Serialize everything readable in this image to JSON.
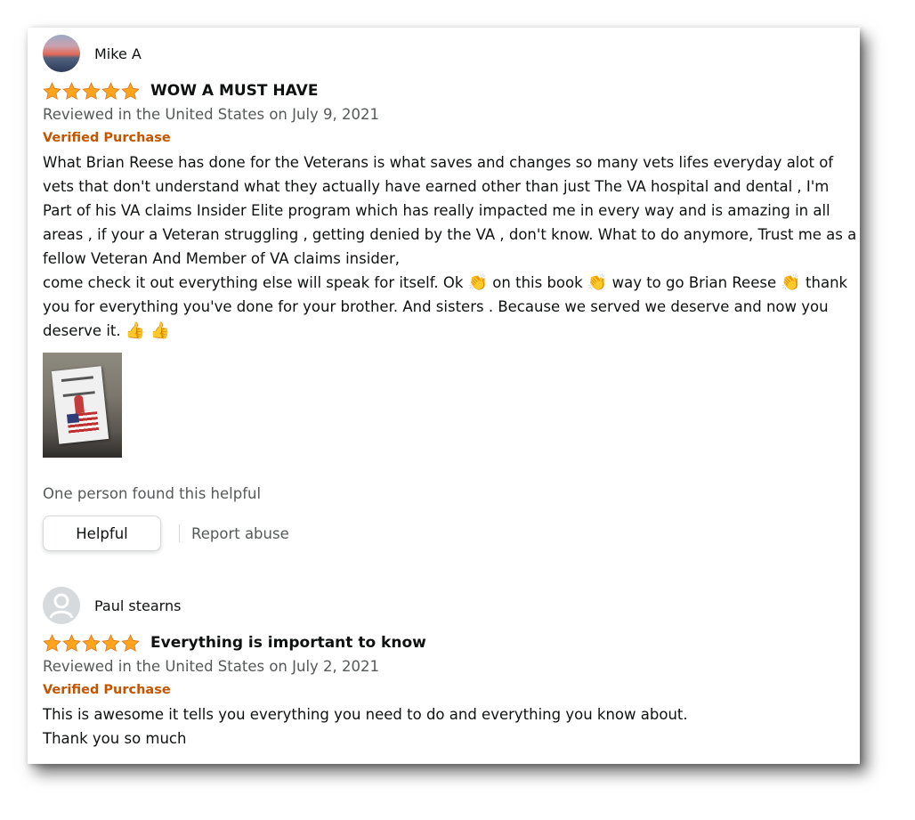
{
  "reviews": [
    {
      "reviewer": "Mike A",
      "rating": 5,
      "title": "WOW A MUST HAVE",
      "date": "Reviewed in the United States on July 9, 2021",
      "badge": "Verified Purchase",
      "body": [
        "What Brian Reese has done for the Veterans is what saves and changes so many vets lifes everyday alot of vets that don't understand what they actually have earned other than just The VA hospital and dental , I'm Part of his VA claims Insider Elite program which has really impacted me in every way and is amazing in all areas , if your a Veteran struggling , getting denied by the VA , don't know. What to do anymore, Trust me as a fellow Veteran And Member of VA claims insider,",
        "come check it out everything else will speak for itself. Ok",
        "on this book",
        "way to go Brian Reese",
        "thank you for everything you've done for your brother. And sisters . Because we served we deserve and now you deserve it."
      ],
      "emoji": {
        "clap": "👏",
        "thumbs_up": "👍"
      },
      "helpful_text": "One person found this helpful",
      "helpful_button": "Helpful",
      "report_link": "Report abuse"
    },
    {
      "reviewer": "Paul stearns",
      "rating": 5,
      "title": "Everything is important to know",
      "date": "Reviewed in the United States on July 2, 2021",
      "badge": "Verified Purchase",
      "body": [
        "This is awesome it tells you everything you need to do and everything you know about.",
        "Thank you so much"
      ]
    }
  ],
  "colors": {
    "star": "#ffa41c",
    "verified": "#c45500",
    "secondary_text": "#565959",
    "primary_text": "#0f1111"
  }
}
